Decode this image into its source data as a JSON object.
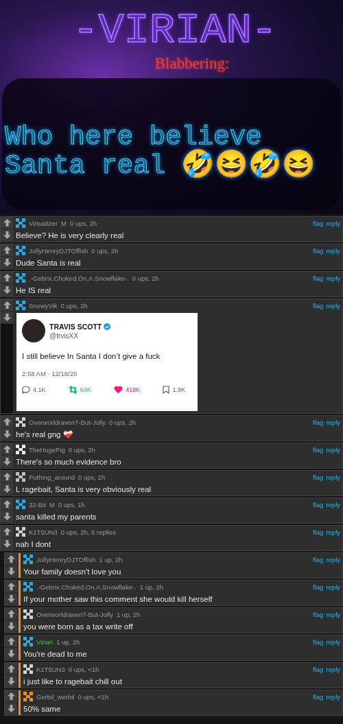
{
  "header": {
    "title": "-VIRIAN-",
    "subtitle": "Blabbering:",
    "post_text": "Who here believe Santa real 🤣😆🤣😆"
  },
  "comments": [
    {
      "kind": "text",
      "user": "Virtualizer",
      "op": false,
      "badge": "M",
      "meta": "0 ups, 2h",
      "color": "#29a9e0",
      "text": "Believe? He is very clearly real",
      "actions": [
        "flag",
        "reply"
      ]
    },
    {
      "kind": "text",
      "user": "JollyHenryDJTOffish",
      "op": false,
      "meta": "0 ups, 2h",
      "color": "#29a9e0",
      "text": "Dude Santa is real",
      "actions": [
        "flag",
        "reply"
      ]
    },
    {
      "kind": "text",
      "user": ".-Gebrix.Choked.On.A.Snowflake-.",
      "op": false,
      "meta": "0 ups, 2h",
      "color": "#29a9e0",
      "text": "He IS real",
      "actions": [
        "flag",
        "reply"
      ]
    },
    {
      "kind": "tweet",
      "user": "SnowyVik",
      "op": false,
      "meta": "0 ups, 2h",
      "color": "#29a9e0",
      "tweet": {
        "name": "TRAVIS SCOTT",
        "handle": "@trvisXX",
        "text": "I still believe In Santa I don’t give a fuck",
        "time": "2:58 AM · 12/18/20",
        "stats": [
          {
            "kind": "reply",
            "value": "4.1K"
          },
          {
            "kind": "retweet",
            "value": "64K"
          },
          {
            "kind": "like",
            "value": "418K"
          },
          {
            "kind": "bookmark",
            "value": "1.9K"
          }
        ]
      },
      "actions": [
        "flag",
        "reply"
      ]
    },
    {
      "kind": "text",
      "user": "Overworldraven7-But-Jolly",
      "op": false,
      "meta": "0 ups, 2h",
      "color": "#d0d0d0",
      "text": "he's real gng ❤️‍🩹",
      "actions": [
        "flag",
        "reply"
      ]
    },
    {
      "kind": "text",
      "user": "TheHugePig",
      "op": false,
      "meta": "0 ups, 2h",
      "color": "#e8e8e8",
      "text": "There's so much evidence bro",
      "actions": [
        "flag",
        "reply"
      ]
    },
    {
      "kind": "text",
      "user": "Puthing_around",
      "op": false,
      "meta": "0 ups, 2h",
      "color": "#bdbdbd",
      "text": "L ragebait, Santa is very obviously real",
      "actions": [
        "flag",
        "reply"
      ]
    },
    {
      "kind": "text",
      "user": "32-Bit",
      "op": false,
      "badge": "M",
      "meta": "0 ups, 1h",
      "color": "#29a9e0",
      "text": "santa killed my parents",
      "actions": [
        "flag",
        "reply"
      ]
    },
    {
      "kind": "text",
      "user": "K1T5UN3",
      "op": false,
      "meta": "0 ups, 2h, 6 replies",
      "color": "#d0d0d0",
      "text": "nah I dont",
      "actions": [
        "flag",
        "reply"
      ],
      "replies": [
        {
          "kind": "text",
          "user": "JollyHenryDJTOffish",
          "op": false,
          "meta": "1 up, 2h",
          "color": "#29a9e0",
          "text": "Your family doesn't love you",
          "actions": [
            "flag",
            "reply"
          ]
        },
        {
          "kind": "text",
          "user": ".-Gebrix.Choked.On.A.Snowflake-.",
          "op": false,
          "meta": "1 up, 2h",
          "color": "#29a9e0",
          "text": "If your mother saw this comment she would kill herself",
          "actions": [
            "flag",
            "reply"
          ]
        },
        {
          "kind": "text",
          "user": "Overworldraven7-But-Jolly",
          "op": false,
          "meta": "1 up, 2h",
          "color": "#d0d0d0",
          "text": "you were born as a tax write off",
          "actions": [
            "flag",
            "reply"
          ]
        },
        {
          "kind": "text",
          "user": "Virian",
          "op": true,
          "meta": "1 up, 2h",
          "color": "#29a9e0",
          "text": "You're dead to me",
          "actions": [
            "flag",
            "reply"
          ]
        },
        {
          "kind": "text",
          "user": "K1T5UN3",
          "op": false,
          "meta": "0 ups, <1h",
          "color": "#d0d0d0",
          "text": "i just like to ragebait chill out",
          "actions": [
            "flag",
            "reply"
          ]
        },
        {
          "kind": "text",
          "user": "Gerbil_werbil",
          "op": false,
          "meta": "0 ups, <1h",
          "color": "#f08a1c",
          "text": "50% same",
          "actions": [
            "flag",
            "reply"
          ]
        }
      ]
    }
  ]
}
